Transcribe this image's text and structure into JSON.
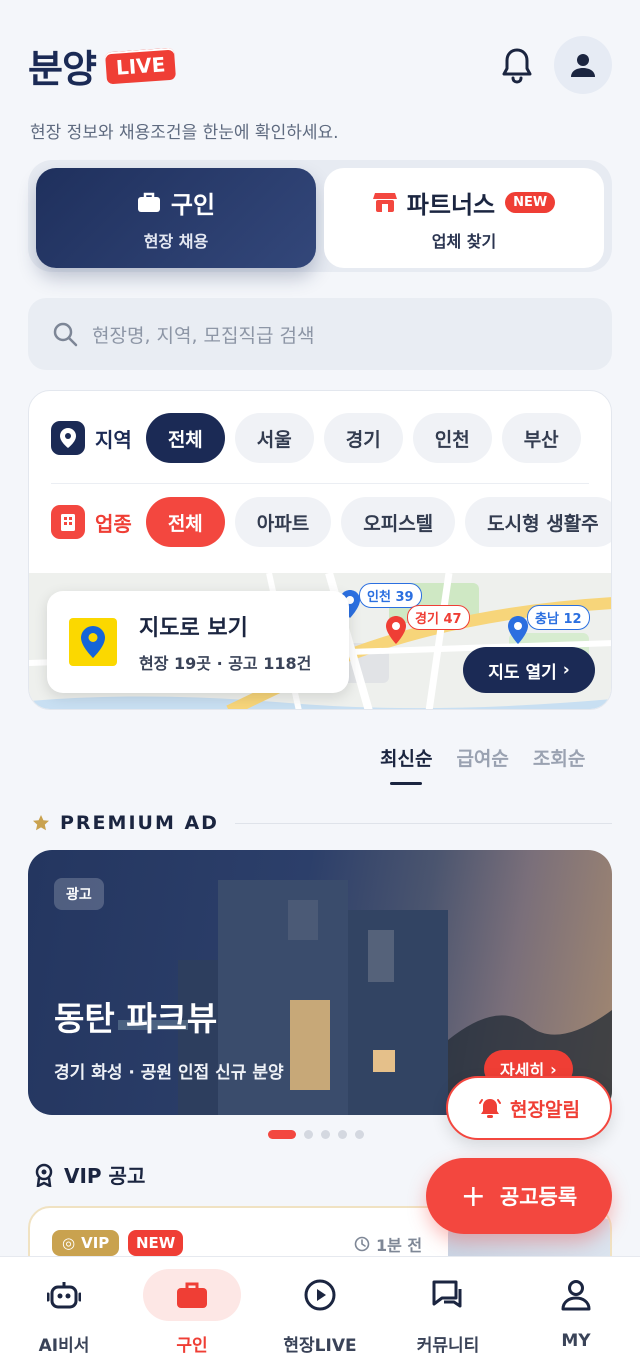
{
  "header": {
    "brand": "분양",
    "live_badge": "LIVE",
    "subtitle": "현장 정보와 채용조건을 한눈에 확인하세요."
  },
  "segment": {
    "left": {
      "title": "구인",
      "subtitle": "현장 채용"
    },
    "right": {
      "title": "파트너스",
      "badge": "NEW",
      "subtitle": "업체 찾기"
    }
  },
  "search": {
    "placeholder": "현장명, 지역, 모집직급 검색"
  },
  "filters": {
    "region": {
      "label": "지역",
      "options": [
        "전체",
        "서울",
        "경기",
        "인천",
        "부산"
      ],
      "selected": "전체"
    },
    "industry": {
      "label": "업종",
      "options": [
        "전체",
        "아파트",
        "오피스텔",
        "도시형 생활주"
      ],
      "selected": "전체"
    }
  },
  "map": {
    "title": "지도로 보기",
    "subtitle": "현장 19곳 · 공고 118건",
    "open_button": "지도 열기",
    "pins": [
      "인천 39",
      "경기 47",
      "충남 12"
    ]
  },
  "sort": {
    "options": [
      "최신순",
      "급여순",
      "조회순"
    ],
    "selected": "최신순"
  },
  "premium": {
    "section_title": "PREMIUM AD",
    "ad_tag": "광고",
    "title": "동탄 파크뷰",
    "subtitle": "경기 화성 · 공원 인접 신규 분양",
    "detail_button": "자세히"
  },
  "carousel": {
    "count": 5,
    "active": 0
  },
  "alert_button": "현장알림",
  "vip": {
    "section_title": "VIP 공고",
    "badge": "VIP",
    "new_badge": "NEW",
    "time": "1분 전"
  },
  "register_button": "공고등록",
  "bottom_nav": {
    "items": [
      "AI비서",
      "구인",
      "현장LIVE",
      "커뮤니티",
      "MY"
    ],
    "active": "구인"
  },
  "colors": {
    "navy": "#1b2a55",
    "accent_red": "#ef3e35",
    "background": "#f4f6fa",
    "vip_gold": "#c9a24f"
  }
}
